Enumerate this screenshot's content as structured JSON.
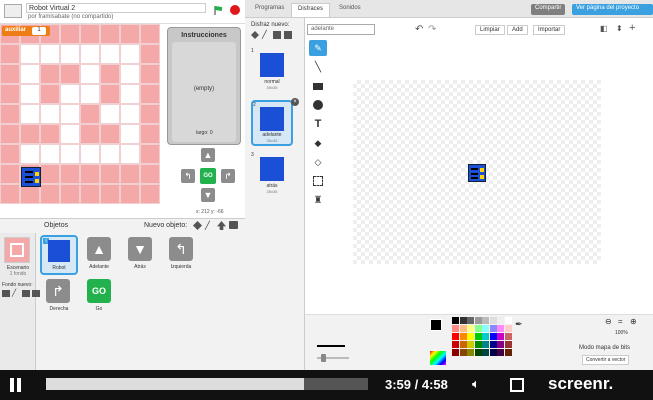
{
  "project": {
    "title": "Robot Virtual 2",
    "author": "por framisabate (no compartido)"
  },
  "stage": {
    "variable_name": "auxiliar",
    "variable_value": "1",
    "instructions_title": "Instrucciones",
    "instructions_empty": "(empty)",
    "instructions_length": "largo: 0",
    "go_label": "GO",
    "coords": "x: 212  y: -66"
  },
  "sprites": {
    "header": "Objetos",
    "new_label": "Nuevo objeto:",
    "scene_label": "Escenario",
    "scene_sub": "1 fondo",
    "new_background": "Fondo nuevo:",
    "items": [
      {
        "name": "Robot"
      },
      {
        "name": "Adelante"
      },
      {
        "name": "Atrás"
      },
      {
        "name": "Izquierda"
      },
      {
        "name": "Derecha"
      },
      {
        "name": "Go",
        "text": "GO"
      }
    ]
  },
  "tabs": {
    "programs": "Programas",
    "costumes": "Disfraces",
    "sounds": "Sonidos",
    "share": "Compartir",
    "project_page": "Ver página del proyecto"
  },
  "costumes": {
    "header": "Disfraz nuevo:",
    "items": [
      {
        "index": "1",
        "name": "normal",
        "size": "35x35"
      },
      {
        "index": "2",
        "name": "adelante",
        "size": "35x35"
      },
      {
        "index": "3",
        "name": "atrás",
        "size": "35x35"
      }
    ]
  },
  "paint": {
    "costume_name": "adelante",
    "clear": "Limpiar",
    "add": "Add",
    "import": "Importar",
    "zoom": "100%",
    "mode": "Modo mapa de bits",
    "convert": "Convertir a vector"
  },
  "player": {
    "time": "3:59 / 4:58",
    "progress": 0.8,
    "brand": "screenr."
  },
  "colors": {
    "wall": "#f4a8a8",
    "floor": "#ffffff",
    "robot": "#1a4fd6",
    "go": "#22b14c",
    "accent": "#3aa0e0",
    "share": "#7f7f7f"
  }
}
